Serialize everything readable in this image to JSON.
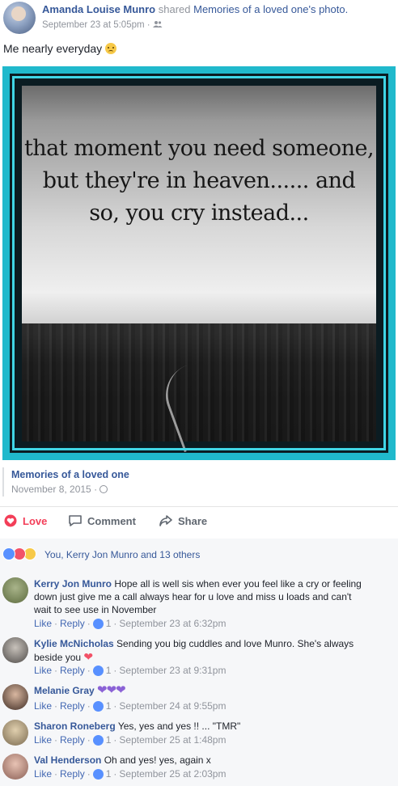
{
  "post": {
    "author": "Amanda Louise Munro",
    "shared_word": "shared",
    "shared_source": "Memories of a loved one's photo.",
    "timestamp": "September 23 at 5:05pm",
    "separator": "·",
    "status_text": "Me nearly everyday"
  },
  "photo": {
    "quote": "that moment you need someone,\nbut they're in heaven...... and\nso, you cry instead..."
  },
  "shared_page": {
    "name": "Memories of a loved one",
    "date": "November 8, 2015",
    "separator": "·"
  },
  "actions": {
    "love": "Love",
    "comment": "Comment",
    "share": "Share"
  },
  "reactions": {
    "summary": "You, Kerry Jon Munro and 13 others"
  },
  "comments": [
    {
      "name": "Kerry Jon Munro",
      "text": "Hope all is well sis when ever you feel like a cry or feeling down just give me a call always hear for u love and miss u loads and can't wait to see use in November",
      "like": "Like",
      "reply": "Reply",
      "count": "1",
      "time": "September 23 at 6:32pm"
    },
    {
      "name": "Kylie McNicholas",
      "text": "Sending you big cuddles and love Munro. She's always beside you",
      "like": "Like",
      "reply": "Reply",
      "count": "1",
      "time": "September 23 at 9:31pm"
    },
    {
      "name": "Melanie Gray",
      "text": "",
      "like": "Like",
      "reply": "Reply",
      "count": "1",
      "time": "September 24 at 9:55pm"
    },
    {
      "name": "Sharon Roneberg",
      "text": "Yes, yes and yes !! ... \"TMR\"",
      "like": "Like",
      "reply": "Reply",
      "count": "1",
      "time": "September 25 at 1:48pm"
    },
    {
      "name": "Val Henderson",
      "text": "Oh and yes! yes, again x",
      "like": "Like",
      "reply": "Reply",
      "count": "1",
      "time": "September 25 at 2:03pm"
    }
  ],
  "meta_separator": "·",
  "colors": {
    "link": "#365899",
    "love": "#f33e58",
    "frame": "#20b9cc",
    "like_badge": "#5890ff"
  }
}
